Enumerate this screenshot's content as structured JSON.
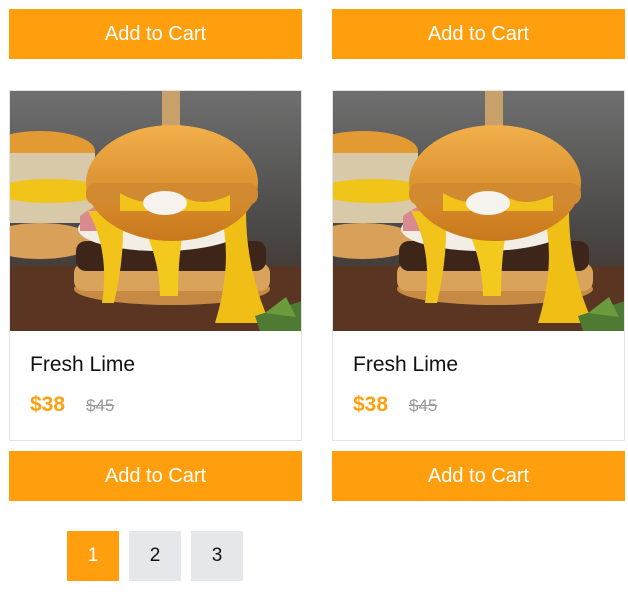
{
  "colors": {
    "accent": "#ff9f0d",
    "page_inactive": "#e5e7eb"
  },
  "top_buttons": [
    {
      "label": "Add to Cart"
    },
    {
      "label": "Add to Cart"
    }
  ],
  "products": [
    {
      "name": "Fresh Lime",
      "price": "$38",
      "old_price": "$45",
      "cart_label": "Add to Cart",
      "image": "burger-image"
    },
    {
      "name": "Fresh Lime",
      "price": "$38",
      "old_price": "$45",
      "cart_label": "Add to Cart",
      "image": "burger-image"
    }
  ],
  "pagination": {
    "pages": [
      "1",
      "2",
      "3"
    ],
    "active": "1"
  }
}
